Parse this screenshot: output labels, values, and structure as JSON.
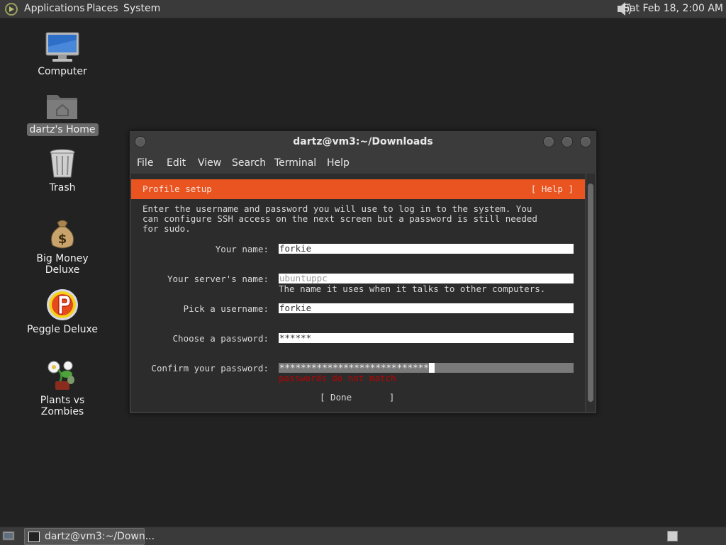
{
  "top_panel": {
    "menus": [
      "Applications",
      "Places",
      "System"
    ],
    "clock": "Sat Feb 18,  2:00 AM"
  },
  "desktop_icons": [
    {
      "label": "Computer",
      "icon": "computer-icon"
    },
    {
      "label": "dartz's Home",
      "icon": "home-folder-icon",
      "selected": true
    },
    {
      "label": "Trash",
      "icon": "trash-icon"
    },
    {
      "label": "Big Money Deluxe",
      "icon": "money-bag-icon"
    },
    {
      "label": "Peggle Deluxe",
      "icon": "peggle-icon"
    },
    {
      "label": "Plants vs Zombies",
      "icon": "plants-vs-zombies-icon"
    }
  ],
  "window": {
    "title": "dartz@vm3:~/Downloads",
    "menu": [
      "File",
      "Edit",
      "View",
      "Search",
      "Terminal",
      "Help"
    ]
  },
  "installer": {
    "header_title": "Profile setup",
    "help": "[ Help ]",
    "intro": "Enter the username and password you will use to log in to the system. You\ncan configure SSH access on the next screen but a password is still needed\nfor sudo.",
    "fields": {
      "name_label": "Your name:",
      "name_value": "forkie",
      "server_label": "Your server's name:",
      "server_placeholder": "ubuntuppc",
      "server_hint": "The name it uses when it talks to other computers.",
      "username_label": "Pick a username:",
      "username_value": "forkie",
      "password_label": "Choose a password:",
      "password_value": "******",
      "confirm_label": "Confirm your password:",
      "confirm_value": "****************************",
      "confirm_error": "passwords do not match"
    },
    "done": "[ Done       ]",
    "accent": "#e95420"
  },
  "bottom_panel": {
    "task_label": "dartz@vm3:~/Down..."
  }
}
